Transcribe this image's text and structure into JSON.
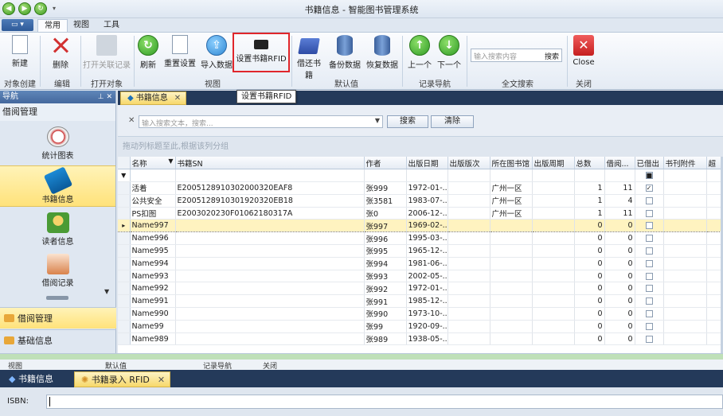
{
  "window": {
    "title": "书籍信息 - 智能图书管理系统"
  },
  "ribbon": {
    "tabs": [
      "常用",
      "视图",
      "工具"
    ],
    "buttons": {
      "new": "新建",
      "delete": "删除",
      "open_related": "打开关联记录",
      "refresh": "刷新",
      "reset_settings": "重置设置",
      "import": "导入数据",
      "set_rfid": "设置书籍RFID",
      "borrow": "借还书籍",
      "backup": "备份数据",
      "restore": "恢复数据",
      "prev": "上一个",
      "next": "下一个",
      "close": "Close"
    },
    "search": {
      "placeholder": "输入搜索内容",
      "button": "搜索"
    },
    "groups": {
      "object_create": "对象创建",
      "edit": "编辑",
      "open_object": "打开对象",
      "view": "视图",
      "default": "默认值",
      "record_nav": "记录导航",
      "fulltext": "全文搜索",
      "close": "关闭"
    }
  },
  "nav": {
    "header": "导航",
    "section": "借阅管理",
    "items": [
      "统计图表",
      "书籍信息",
      "读者信息",
      "借阅记录"
    ],
    "groups": [
      "借阅管理",
      "基础信息"
    ]
  },
  "doc": {
    "tab": "书籍信息",
    "tooltip": "设置书籍RFID"
  },
  "filter": {
    "placeholder": "输入搜索文本，搜索...",
    "search": "搜索",
    "clear": "清除",
    "group_hint": "拖动列标题至此,根据该列分组"
  },
  "grid": {
    "columns": [
      "名称",
      "书籍SN",
      "作者",
      "出版日期",
      "出版版次",
      "所在图书馆",
      "出版周期",
      "总数",
      "借阅...",
      "已借出",
      "书刊附件",
      "超"
    ],
    "rows": [
      {
        "name": "活着",
        "sn": "E2005128910302000320EAF8",
        "author": "张999",
        "date": "1972-01-...",
        "lib": "广州一区",
        "total": "1",
        "borrow": "11",
        "out": true
      },
      {
        "name": "公共安全",
        "sn": "E2005128910301920320EB18",
        "author": "张3581",
        "date": "1983-07-...",
        "lib": "广州一区",
        "total": "1",
        "borrow": "4",
        "out": false
      },
      {
        "name": "PS扣图",
        "sn": "E2003020230F01062180317A",
        "author": "张0",
        "date": "2006-12-...",
        "lib": "广州一区",
        "total": "1",
        "borrow": "11",
        "out": false
      },
      {
        "name": "Name997",
        "sn": "",
        "author": "张997",
        "date": "1969-02-...",
        "lib": "",
        "total": "0",
        "borrow": "0",
        "out": false
      },
      {
        "name": "Name996",
        "sn": "",
        "author": "张996",
        "date": "1995-03-...",
        "lib": "",
        "total": "0",
        "borrow": "0",
        "out": false
      },
      {
        "name": "Name995",
        "sn": "",
        "author": "张995",
        "date": "1965-12-...",
        "lib": "",
        "total": "0",
        "borrow": "0",
        "out": false
      },
      {
        "name": "Name994",
        "sn": "",
        "author": "张994",
        "date": "1981-06-...",
        "lib": "",
        "total": "0",
        "borrow": "0",
        "out": false
      },
      {
        "name": "Name993",
        "sn": "",
        "author": "张993",
        "date": "2002-05-...",
        "lib": "",
        "total": "0",
        "borrow": "0",
        "out": false
      },
      {
        "name": "Name992",
        "sn": "",
        "author": "张992",
        "date": "1972-01-...",
        "lib": "",
        "total": "0",
        "borrow": "0",
        "out": false
      },
      {
        "name": "Name991",
        "sn": "",
        "author": "张991",
        "date": "1985-12-...",
        "lib": "",
        "total": "0",
        "borrow": "0",
        "out": false
      },
      {
        "name": "Name990",
        "sn": "",
        "author": "张990",
        "date": "1973-10-...",
        "lib": "",
        "total": "0",
        "borrow": "0",
        "out": false
      },
      {
        "name": "Name99",
        "sn": "",
        "author": "张99",
        "date": "1920-09-...",
        "lib": "",
        "total": "0",
        "borrow": "0",
        "out": false
      },
      {
        "name": "Name989",
        "sn": "",
        "author": "张989",
        "date": "1938-05-...",
        "lib": "",
        "total": "0",
        "borrow": "0",
        "out": false
      }
    ]
  },
  "strip": {
    "labels": [
      "视图",
      "默认值",
      "记录导航",
      "关闭"
    ]
  },
  "bottom": {
    "tabs": [
      "书籍信息",
      "书籍录入 RFID"
    ],
    "isbn_label": "ISBN:",
    "isbn_value": ""
  },
  "colors": {
    "accent": "#243a5a",
    "selection": "#ffe27a",
    "highlight_border": "#e0262b"
  }
}
